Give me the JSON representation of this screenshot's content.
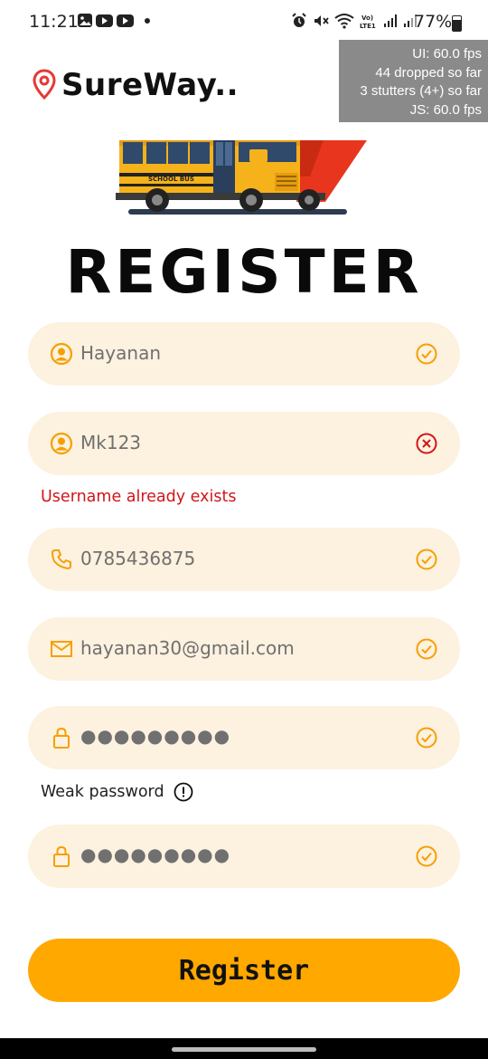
{
  "status_bar": {
    "time": "11:21",
    "battery": "77%",
    "left_icons": [
      "gallery-icon",
      "youtube-icon",
      "youtube-icon",
      "notification-dot"
    ],
    "right_icons": [
      "alarm-icon",
      "mute-icon",
      "wifi-icon",
      "volte-icon",
      "signal-icon",
      "signal-icon"
    ]
  },
  "perf_overlay": {
    "ui_fps": "UI: 60.0 fps",
    "dropped": "44 dropped so far",
    "stutters": "3 stutters (4+) so far",
    "js_fps": "JS: 60.0 fps"
  },
  "brand": {
    "name": "SureWay..",
    "pin_color": "#e53935"
  },
  "illustration": {
    "bus_label": "SCHOOL BUS"
  },
  "title": "REGISTER",
  "form": {
    "name": {
      "value": "Hayanan",
      "icon": "user-icon",
      "state": "valid"
    },
    "username": {
      "value": "Mk123",
      "icon": "user-icon",
      "state": "invalid",
      "error": "Username already exists"
    },
    "phone": {
      "value": "0785436875",
      "icon": "phone-icon",
      "state": "valid"
    },
    "email": {
      "value": "hayanan30@gmail.com",
      "icon": "mail-icon",
      "state": "valid"
    },
    "password": {
      "value": "●●●●●●●●●",
      "icon": "lock-icon",
      "state": "valid",
      "hint": "Weak password"
    },
    "confirm_password": {
      "value": "●●●●●●●●●",
      "icon": "lock-icon",
      "state": "valid"
    }
  },
  "register_button": "Register",
  "colors": {
    "accent": "#ffa800",
    "field_bg": "#fdf1df",
    "icon": "#f5a000",
    "error": "#d0161b"
  }
}
